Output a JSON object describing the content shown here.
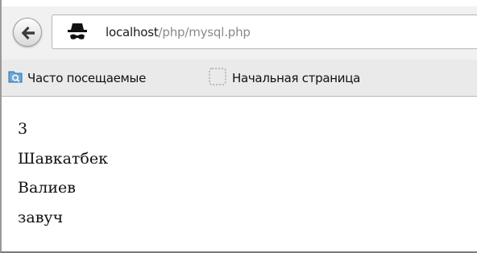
{
  "browser": {
    "back_button_label": "Back",
    "url": {
      "host": "localhost",
      "path": "/php/mysql.php"
    },
    "bookmarks": [
      {
        "label": "Часто посещаемые",
        "icon": "most-visited-folder-icon"
      },
      {
        "label": "Начальная страница",
        "icon": "blank-page-icon"
      }
    ]
  },
  "page": {
    "lines": [
      "3",
      "Шавкатбек",
      "Валиев",
      "завуч"
    ]
  }
}
